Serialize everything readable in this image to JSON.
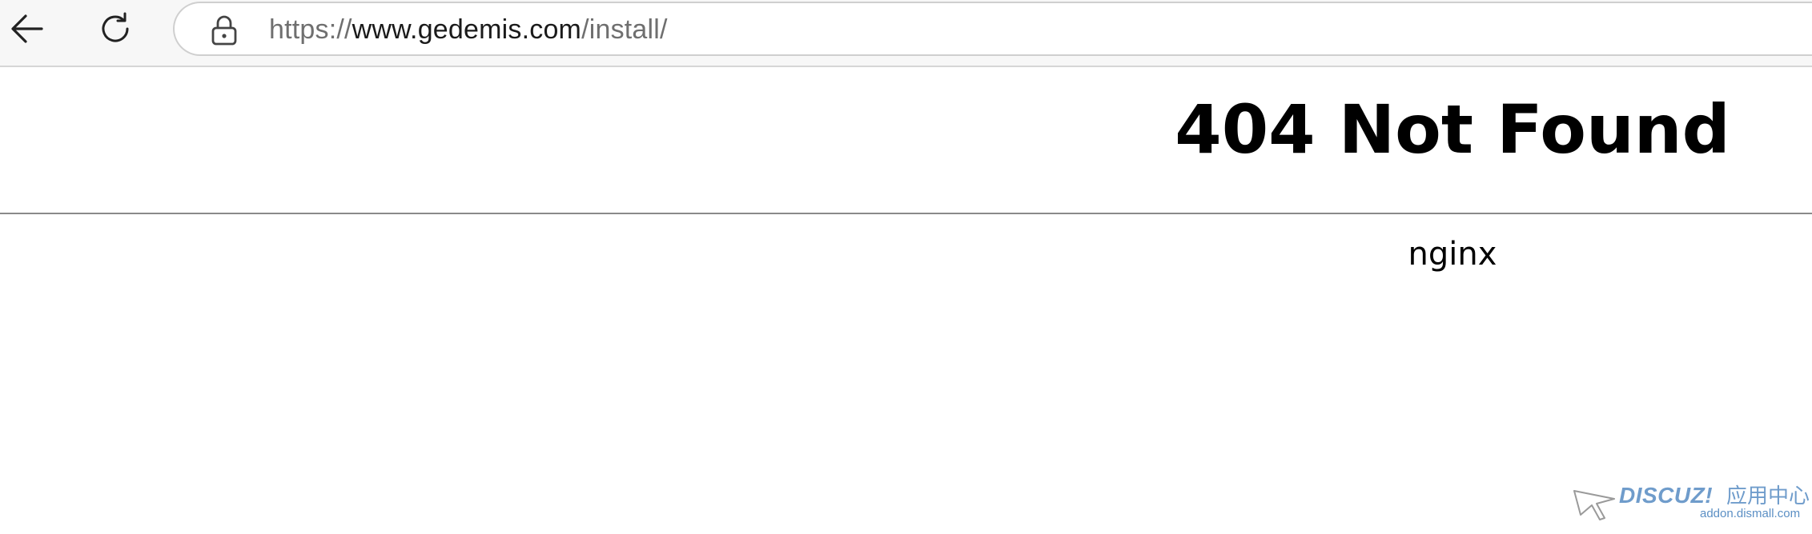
{
  "browser": {
    "back_icon": "arrow-left-icon",
    "reload_icon": "reload-icon",
    "lock_icon": "lock-icon",
    "url": {
      "scheme": "https://",
      "host": "www.gedemis.com",
      "path": "/install/"
    }
  },
  "page": {
    "title": "404 Not Found",
    "server": "nginx"
  },
  "watermark": {
    "brand": "DISCUZ!",
    "brand_cn": "应用中心",
    "site": "addon.dismall.com",
    "color": "#6f9ccb"
  }
}
